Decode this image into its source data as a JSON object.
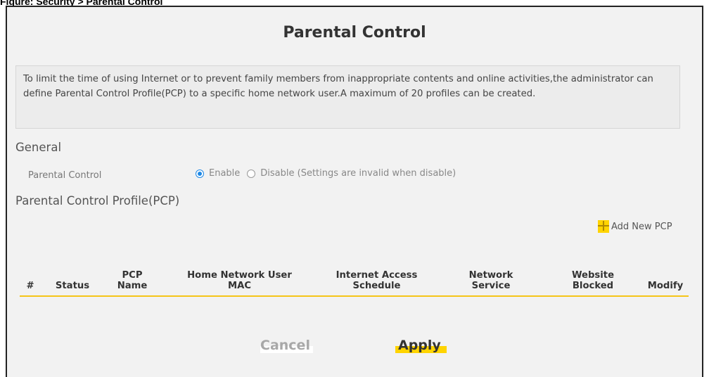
{
  "figure_caption": "Figure: Security > Parental Control",
  "page": {
    "title": "Parental Control"
  },
  "info": {
    "text": "To limit the time of using Internet or to prevent family members from inappropriate contents and online activities,the administrator can define Parental Control Profile(PCP) to a specific home network user.A maximum of 20 profiles can be created."
  },
  "general": {
    "heading": "General",
    "parental_control_label": "Parental Control",
    "enable_label": "Enable",
    "disable_label": "Disable (Settings are invalid when disable)",
    "selected": "Enable"
  },
  "pcp": {
    "heading": "Parental Control Profile(PCP)",
    "add_new_label": "Add New PCP",
    "columns": [
      "#",
      "Status",
      "PCP Name",
      "Home Network User MAC",
      "Internet Access Schedule",
      "Network Service",
      "Website Blocked",
      "Modify"
    ],
    "rows": []
  },
  "actions": {
    "cancel_label": "Cancel",
    "apply_label": "Apply"
  },
  "colors": {
    "accent": "#ffd400",
    "radio_selected": "#1e88e5",
    "panel_bg": "#f2f2f2"
  }
}
